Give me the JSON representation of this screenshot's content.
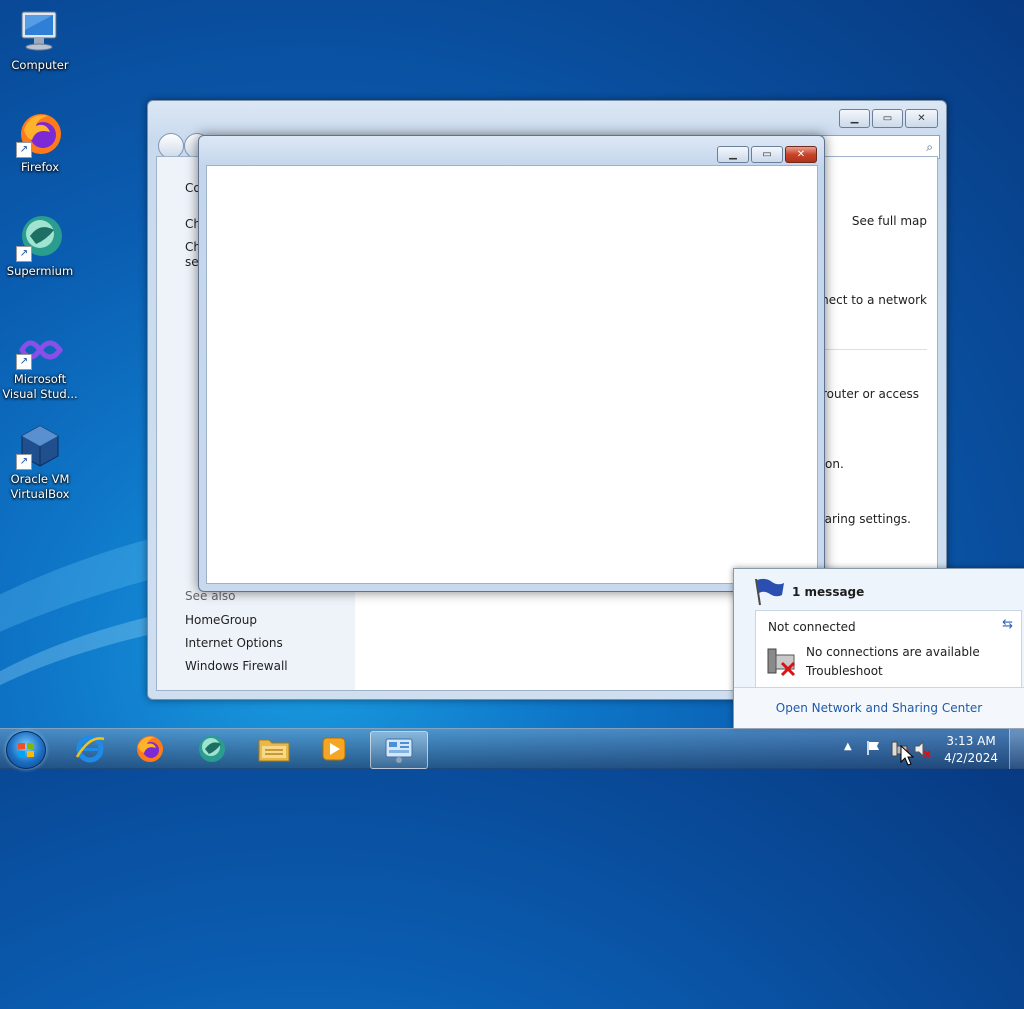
{
  "desktop": {
    "icons": [
      {
        "label_lines": [
          "Computer"
        ]
      },
      {
        "label_lines": [
          "Firefox"
        ]
      },
      {
        "label_lines": [
          "Supermium"
        ]
      },
      {
        "label_lines": [
          "Microsoft",
          "Visual Stud..."
        ]
      },
      {
        "label_lines": [
          "Oracle VM",
          "VirtualBox"
        ]
      }
    ]
  },
  "back_window": {
    "left_items_partial": [
      "Co",
      "Ch",
      "Ch",
      "set"
    ],
    "see_also_label": "See also",
    "see_also_links": [
      "HomeGroup",
      "Internet Options",
      "Windows Firewall"
    ],
    "right_links": {
      "see_full_map": "See full map",
      "connect_partial": "onnect to a network"
    },
    "right_text_partial": {
      "router": "a router or access",
      "tion": "tion.",
      "sharing": "haring settings."
    }
  },
  "notification": {
    "message_count": "1 message",
    "status": "Not connected",
    "no_connections": "No connections are available",
    "troubleshoot": "Troubleshoot",
    "open_center": "Open Network and Sharing Center"
  },
  "taskbar": {
    "time": "3:13 AM",
    "date": "4/2/2024"
  },
  "colors": {
    "link": "#1e5aa8",
    "desktop_blue": "#0a5cb0"
  }
}
